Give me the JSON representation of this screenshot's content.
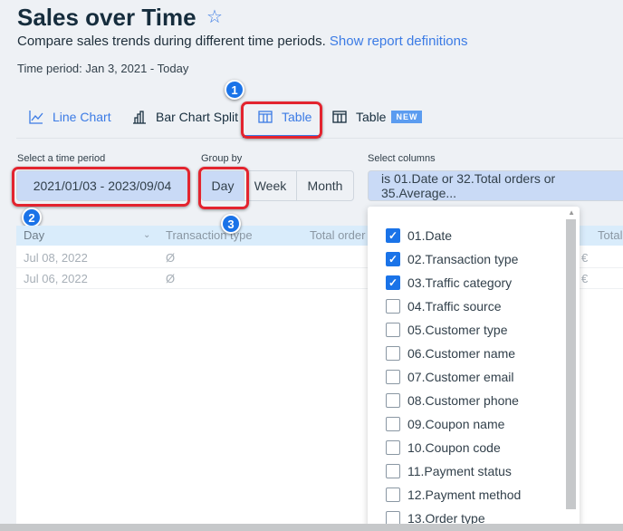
{
  "header": {
    "title": "Sales over Time",
    "subtitle": "Compare sales trends during different time periods.",
    "link": "Show report definitions",
    "time_period": "Time period: Jan 3, 2021 - Today"
  },
  "tabs": [
    {
      "label": "Line Chart"
    },
    {
      "label": "Bar Chart Split"
    },
    {
      "label": "Table",
      "active": true
    },
    {
      "label": "Table",
      "badge": "NEW"
    }
  ],
  "annotations": [
    "1",
    "2",
    "3"
  ],
  "filters": {
    "time_label": "Select a time period",
    "time_value": "2021/01/03 - 2023/09/04",
    "group_label": "Group by",
    "group_options": [
      "Day",
      "Week",
      "Month"
    ],
    "group_selected": "Day",
    "columns_label": "Select columns",
    "columns_value": "is 01.Date or 32.Total orders or 35.Average..."
  },
  "table": {
    "headers": [
      "Day",
      "Transaction type",
      "Total order",
      "Total"
    ],
    "rows": [
      [
        "Jul 08, 2022",
        "Ø",
        "€"
      ],
      [
        "Jul 06, 2022",
        "Ø",
        "€"
      ]
    ]
  },
  "dropdown": {
    "items": [
      {
        "label": "01.Date",
        "checked": true
      },
      {
        "label": "02.Transaction type",
        "checked": true
      },
      {
        "label": "03.Traffic category",
        "checked": true
      },
      {
        "label": "04.Traffic source",
        "checked": false
      },
      {
        "label": "05.Customer type",
        "checked": false
      },
      {
        "label": "06.Customer name",
        "checked": false
      },
      {
        "label": "07.Customer email",
        "checked": false
      },
      {
        "label": "08.Customer phone",
        "checked": false
      },
      {
        "label": "09.Coupon name",
        "checked": false
      },
      {
        "label": "10.Coupon code",
        "checked": false
      },
      {
        "label": "11.Payment status",
        "checked": false
      },
      {
        "label": "12.Payment method",
        "checked": false
      },
      {
        "label": "13.Order type",
        "checked": false
      }
    ]
  },
  "colors": {
    "accent": "#3b7be5",
    "annotation": "#e3242f"
  }
}
